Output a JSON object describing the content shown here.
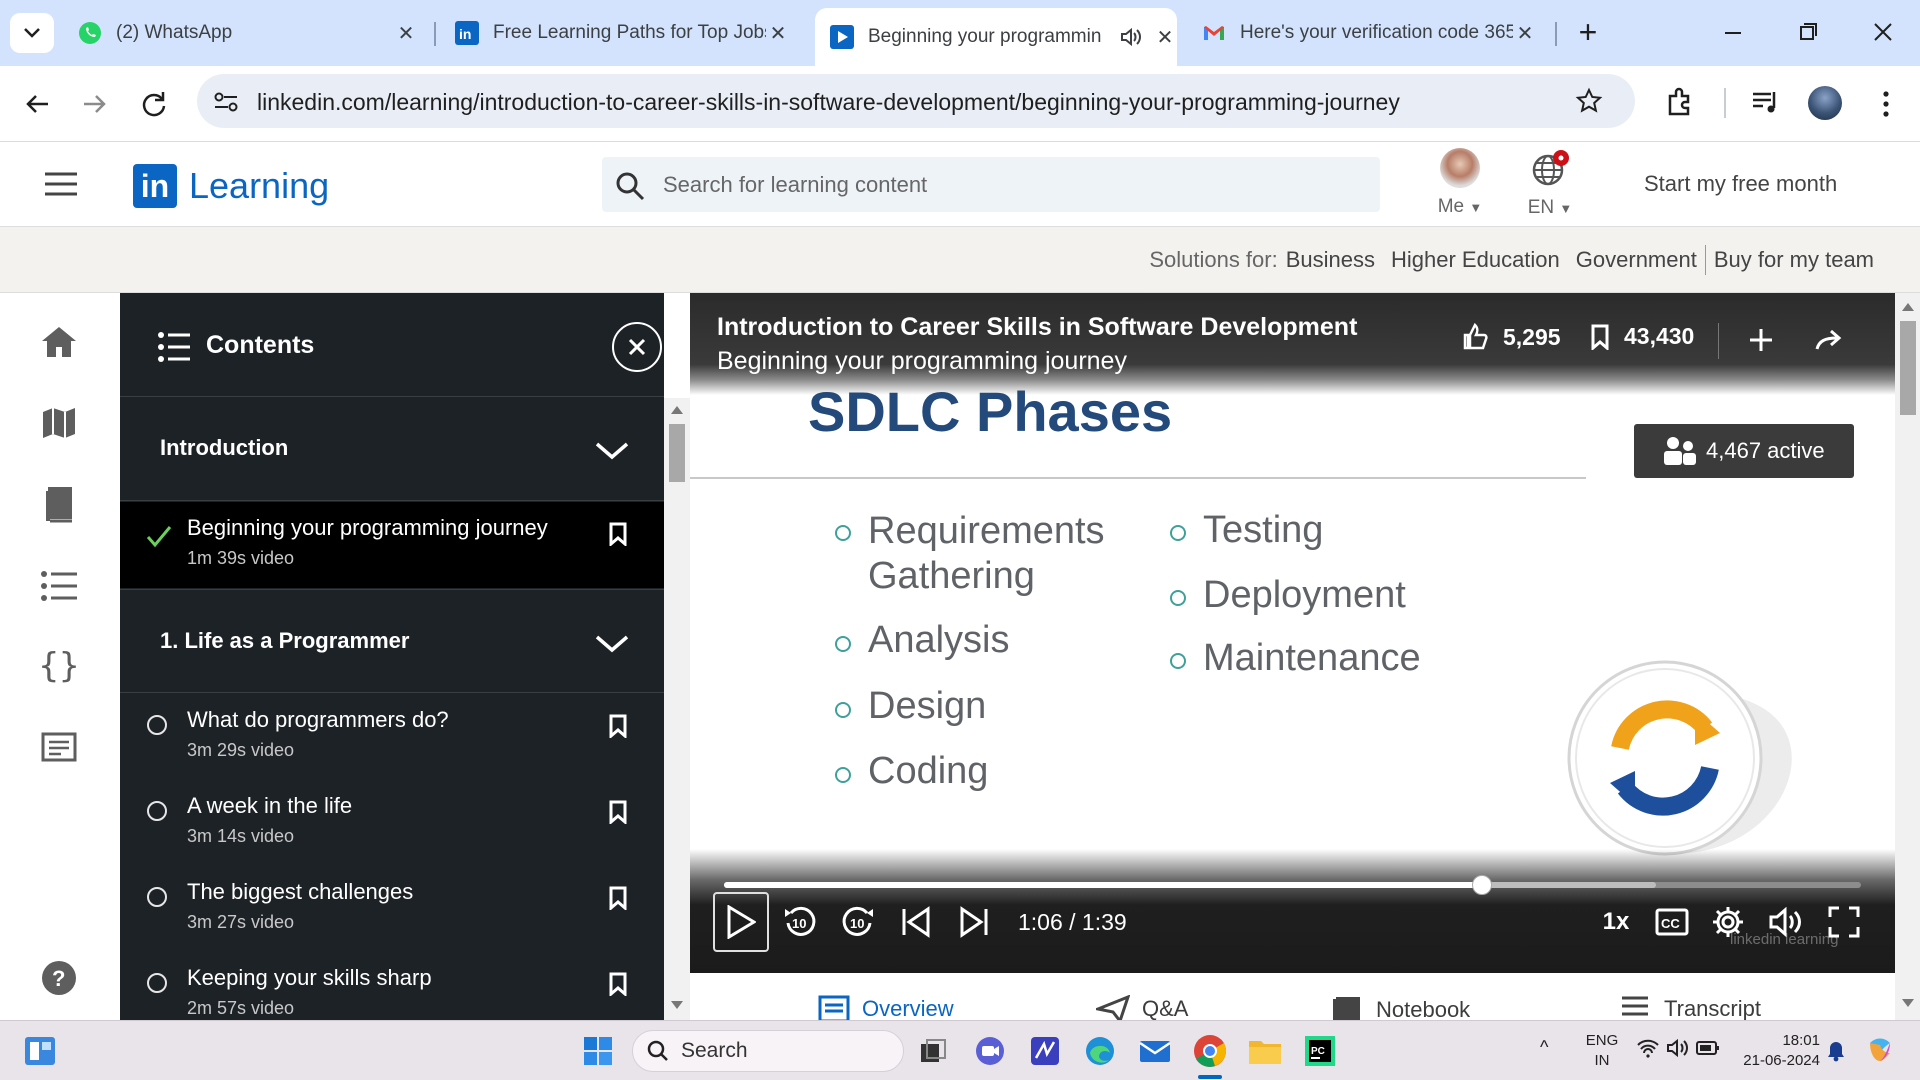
{
  "browser": {
    "tabs": [
      {
        "title": "(2) WhatsApp",
        "icon": "whatsapp-icon",
        "active": false
      },
      {
        "title": "Free Learning Paths for Top Jobs",
        "icon": "linkedin-icon",
        "active": false
      },
      {
        "title": "Beginning your programmin",
        "icon": "linkedin-learning-icon",
        "active": true
      },
      {
        "title": "Here's your verification code 365",
        "icon": "gmail-icon",
        "active": false
      }
    ],
    "url": "linkedin.com/learning/introduction-to-career-skills-in-software-development/beginning-your-programming-journey"
  },
  "header": {
    "logo_in": "in",
    "logo_text": "Learning",
    "search_placeholder": "Search for learning content",
    "me_label": "Me",
    "lang_label": "EN",
    "cta": "Start my free month"
  },
  "subnav": {
    "prefix": "Solutions for:",
    "links": [
      "Business",
      "Higher Education",
      "Government"
    ],
    "buy": "Buy for my team"
  },
  "contents": {
    "title": "Contents",
    "sections": [
      {
        "title": "Introduction"
      },
      {
        "title": "1. Life as a Programmer"
      }
    ],
    "intro_items": [
      {
        "title": "Beginning your programming journey",
        "duration": "1m 39s video",
        "completed": true
      }
    ],
    "chapter1_items": [
      {
        "title": "What do programmers do?",
        "duration": "3m 29s video"
      },
      {
        "title": "A week in the life",
        "duration": "3m 14s video"
      },
      {
        "title": "The biggest challenges",
        "duration": "3m 27s video"
      },
      {
        "title": "Keeping your skills sharp",
        "duration": "2m 57s video"
      }
    ]
  },
  "video": {
    "course_title": "Introduction to Career Skills in Software Development",
    "lesson_title": "Beginning your programming journey",
    "likes": "5,295",
    "saves": "43,430",
    "active": "4,467 active",
    "slide_title": "SDLC Phases",
    "bullets_left": [
      [
        "Requirements",
        "Gathering"
      ],
      [
        "Analysis"
      ],
      [
        "Design"
      ],
      [
        "Coding"
      ]
    ],
    "bullets_right": [
      "Testing",
      "Deployment",
      "Maintenance"
    ],
    "time": "1:06 / 1:39",
    "progress": 0.667,
    "buffered": 0.82,
    "speed": "1x",
    "watermark": "linkedin learning"
  },
  "video_tabs": [
    "Overview",
    "Q&A",
    "Notebook",
    "Transcript"
  ],
  "taskbar": {
    "search": "Search",
    "lang_top": "ENG",
    "lang_bottom": "IN",
    "time": "18:01",
    "date": "21-06-2024"
  },
  "colors": {
    "linkedin_blue": "#0a66c2",
    "slide_title_blue": "#234a7b",
    "bullet_teal": "#3fa09a",
    "panel_dark": "#1d2226"
  }
}
